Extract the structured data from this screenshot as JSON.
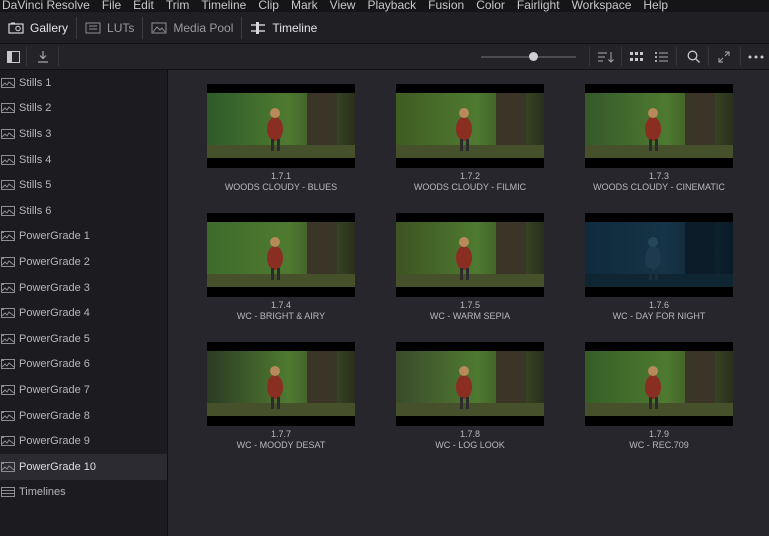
{
  "menu": [
    "DaVinci Resolve",
    "File",
    "Edit",
    "Trim",
    "Timeline",
    "Clip",
    "Mark",
    "View",
    "Playback",
    "Fusion",
    "Color",
    "Fairlight",
    "Workspace",
    "Help"
  ],
  "toolbar": {
    "gallery": "Gallery",
    "luts": "LUTs",
    "media_pool": "Media Pool",
    "timeline": "Timeline"
  },
  "zoom_level": 0.55,
  "sidebar": {
    "items": [
      {
        "label": "Stills 1",
        "icon": "stills-icon"
      },
      {
        "label": "Stills 2",
        "icon": "stills-icon"
      },
      {
        "label": "Stills 3",
        "icon": "stills-icon"
      },
      {
        "label": "Stills 4",
        "icon": "stills-icon"
      },
      {
        "label": "Stills 5",
        "icon": "stills-icon"
      },
      {
        "label": "Stills 6",
        "icon": "stills-icon"
      },
      {
        "label": "PowerGrade 1",
        "icon": "powergrade-icon"
      },
      {
        "label": "PowerGrade 2",
        "icon": "powergrade-icon"
      },
      {
        "label": "PowerGrade 3",
        "icon": "powergrade-icon"
      },
      {
        "label": "PowerGrade 4",
        "icon": "powergrade-icon"
      },
      {
        "label": "PowerGrade 5",
        "icon": "powergrade-icon"
      },
      {
        "label": "PowerGrade 6",
        "icon": "powergrade-icon"
      },
      {
        "label": "PowerGrade 7",
        "icon": "powergrade-icon"
      },
      {
        "label": "PowerGrade 8",
        "icon": "powergrade-icon"
      },
      {
        "label": "PowerGrade 9",
        "icon": "powergrade-icon"
      },
      {
        "label": "PowerGrade 10",
        "icon": "powergrade-icon",
        "selected": true
      },
      {
        "label": "Timelines",
        "icon": "timelines-icon"
      }
    ]
  },
  "stills": [
    {
      "id": "1.7.1",
      "name": "WOODS CLOUDY - BLUES",
      "tint": "#2e5a2a"
    },
    {
      "id": "1.7.2",
      "name": "WOODS CLOUDY - FILMIC",
      "tint": "#3f5c22"
    },
    {
      "id": "1.7.3",
      "name": "WOODS CLOUDY - CINEMATIC",
      "tint": "#35582a"
    },
    {
      "id": "1.7.4",
      "name": "WC - BRIGHT & AIRY",
      "tint": "#3e6a2c"
    },
    {
      "id": "1.7.5",
      "name": "WC - WARM SEPIA",
      "tint": "#3d5322"
    },
    {
      "id": "1.7.6",
      "name": "WC - DAY FOR NIGHT",
      "tint": "#0f2a3d"
    },
    {
      "id": "1.7.7",
      "name": "WC - MOODY DESAT",
      "tint": "#2c3a24"
    },
    {
      "id": "1.7.8",
      "name": "WC - LOG LOOK",
      "tint": "#3a4a2c"
    },
    {
      "id": "1.7.9",
      "name": "WC - REC.709",
      "tint": "#355e27"
    }
  ]
}
